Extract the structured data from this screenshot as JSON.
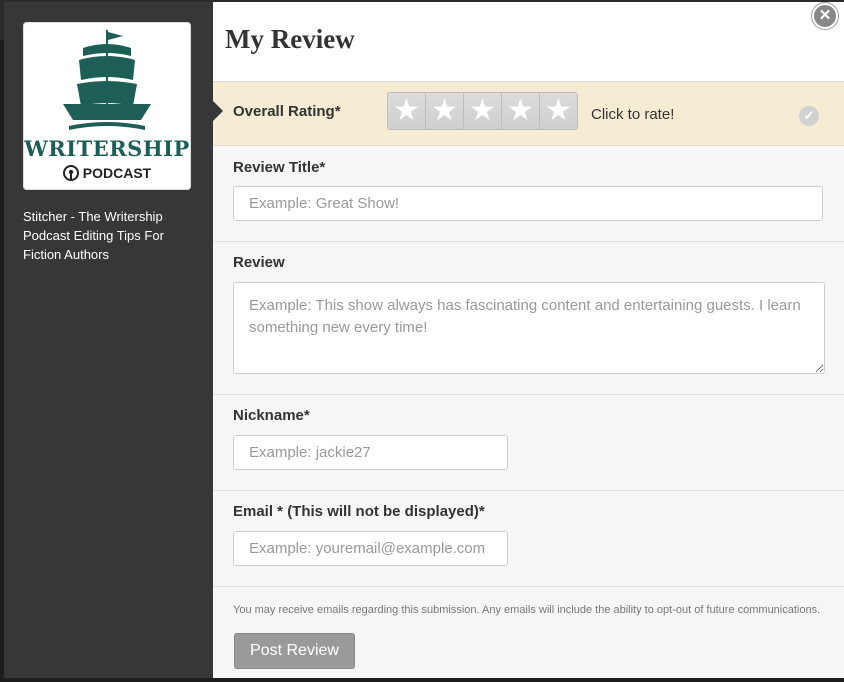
{
  "podcast": {
    "brand_text": "WRITERSHIP",
    "podcast_text": "PODCAST",
    "sidebar_title": "Stitcher - The Writership Podcast Editing Tips For Fiction Authors"
  },
  "dialog": {
    "title": "My Review",
    "close_icon": "close-icon"
  },
  "rating": {
    "label": "Overall Rating*",
    "stars": 0,
    "max_stars": 5,
    "hint": "Click to rate!"
  },
  "review_title": {
    "label": "Review Title*",
    "placeholder": "Example: Great Show!",
    "value": ""
  },
  "review": {
    "label": "Review",
    "placeholder": "Example: This show always has fascinating content and entertaining guests. I learn something new every time!",
    "value": ""
  },
  "nickname": {
    "label": "Nickname*",
    "placeholder": "Example: jackie27",
    "value": ""
  },
  "email": {
    "label": "Email * (This will not be displayed)*",
    "placeholder": "Example: youremail@example.com",
    "value": ""
  },
  "footer": {
    "disclaimer": "You may receive emails regarding this submission. Any emails will include the ability to opt-out of future communications.",
    "submit_label": "Post Review"
  },
  "colors": {
    "sidebar": "#373737",
    "rating_row": "#f5ecd3",
    "brand": "#1d5e57",
    "button": "#9a9a9a"
  }
}
